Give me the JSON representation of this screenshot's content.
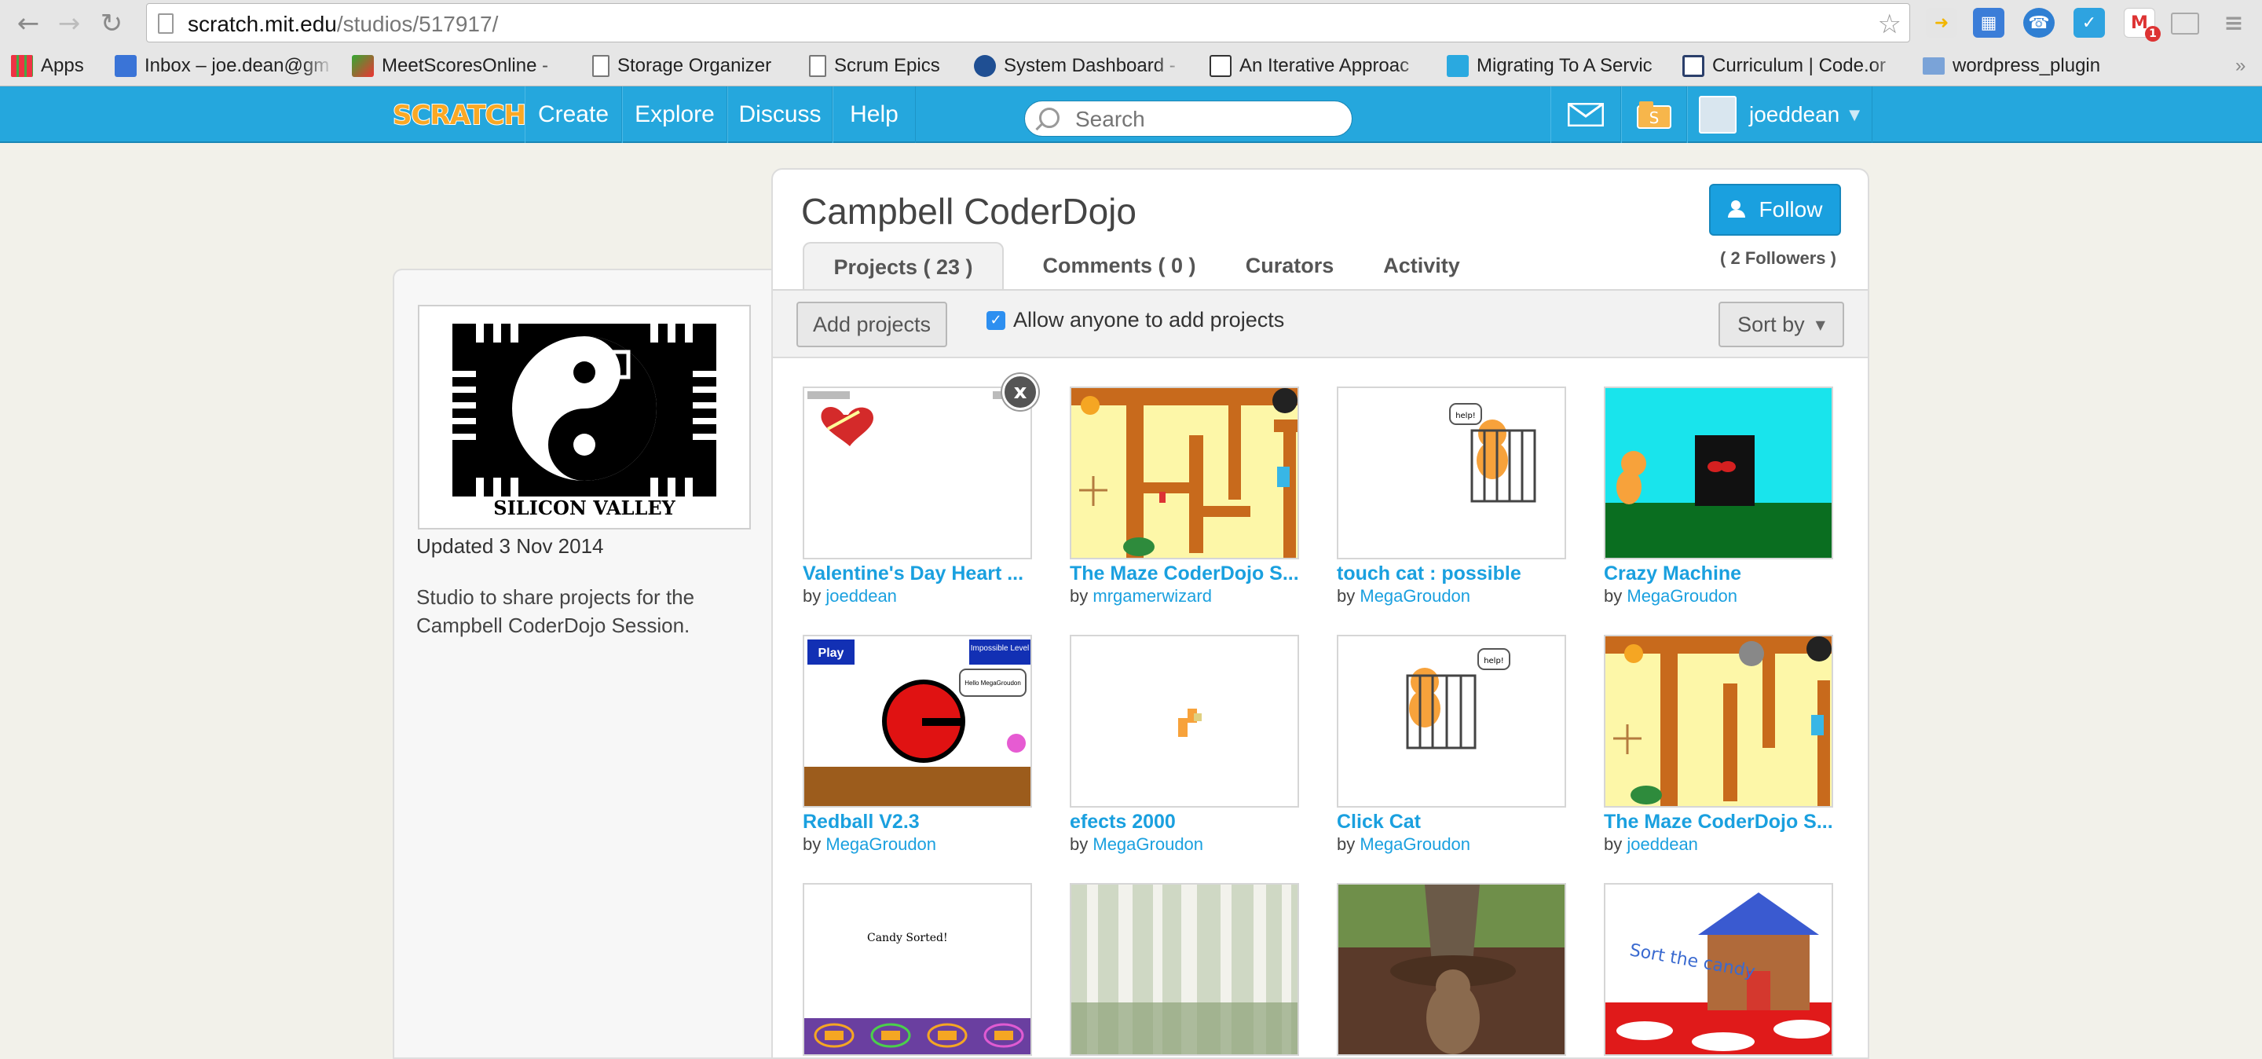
{
  "browser": {
    "url_host": "scratch.mit.edu",
    "url_path": "/studios/517917/",
    "extensions": [
      "bookmark-extension-icon",
      "cal-icon",
      "whatsapp-icon",
      "checkmark-icon",
      "gmail-icon",
      "cast-icon"
    ],
    "gmail_count": "1"
  },
  "bookmarks": [
    {
      "label": "Apps",
      "icon": "apps-grid-icon"
    },
    {
      "label": "Inbox – joe.dean@gm",
      "icon": "inbox-icon"
    },
    {
      "label": "MeetScoresOnline -",
      "icon": "meetscores-icon"
    },
    {
      "label": "Storage Organizer",
      "icon": "page-icon"
    },
    {
      "label": "Scrum Epics",
      "icon": "page-icon"
    },
    {
      "label": "System Dashboard -",
      "icon": "jira-icon"
    },
    {
      "label": "An Iterative Approac",
      "icon": "doc-icon"
    },
    {
      "label": "Migrating To A Servic",
      "icon": "twitter-icon"
    },
    {
      "label": "Curriculum | Code.or",
      "icon": "code-org-icon"
    },
    {
      "label": "wordpress_plugin",
      "icon": "folder-icon"
    }
  ],
  "header": {
    "logo": "SCRATCH",
    "nav": [
      "Create",
      "Explore",
      "Discuss",
      "Help"
    ],
    "search_placeholder": "Search",
    "username": "joeddean"
  },
  "studio": {
    "title": "Campbell CoderDojo",
    "follow_label": "Follow",
    "followers": "( 2 Followers )",
    "tabs": [
      "Projects ( 23 )",
      "Comments ( 0 )",
      "Curators",
      "Activity"
    ],
    "add_projects": "Add projects",
    "allow_label": "Allow anyone to add projects",
    "sort_by": "Sort by",
    "updated": "Updated 3 Nov 2014",
    "description": "Studio to share projects for the Campbell CoderDojo Session.",
    "logo_text": "SILICON VALLEY",
    "remove_label": "x"
  },
  "projects": [
    {
      "title": "Valentine's Day Heart ...",
      "by": "by",
      "author": "joeddean"
    },
    {
      "title": "The Maze CoderDojo S...",
      "by": "by",
      "author": "mrgamerwizard"
    },
    {
      "title": "touch cat : possible",
      "by": "by",
      "author": "MegaGroudon"
    },
    {
      "title": "Crazy Machine",
      "by": "by",
      "author": "MegaGroudon"
    },
    {
      "title": "Redball V2.3",
      "by": "by",
      "author": "MegaGroudon"
    },
    {
      "title": "efects 2000",
      "by": "by",
      "author": "MegaGroudon"
    },
    {
      "title": "Click Cat",
      "by": "by",
      "author": "MegaGroudon"
    },
    {
      "title": "The Maze CoderDojo S...",
      "by": "by",
      "author": "joeddean"
    },
    {
      "title": "",
      "by": "",
      "author": ""
    },
    {
      "title": "",
      "by": "",
      "author": ""
    },
    {
      "title": "",
      "by": "",
      "author": ""
    },
    {
      "title": "",
      "by": "",
      "author": ""
    }
  ],
  "thumb_text": {
    "help": "help!",
    "play": "Play",
    "impossible": "Impossible Level",
    "hello": "Hello MegaGroudon",
    "candy": "Candy Sorted!",
    "sort_candy": "Sort the candy"
  }
}
